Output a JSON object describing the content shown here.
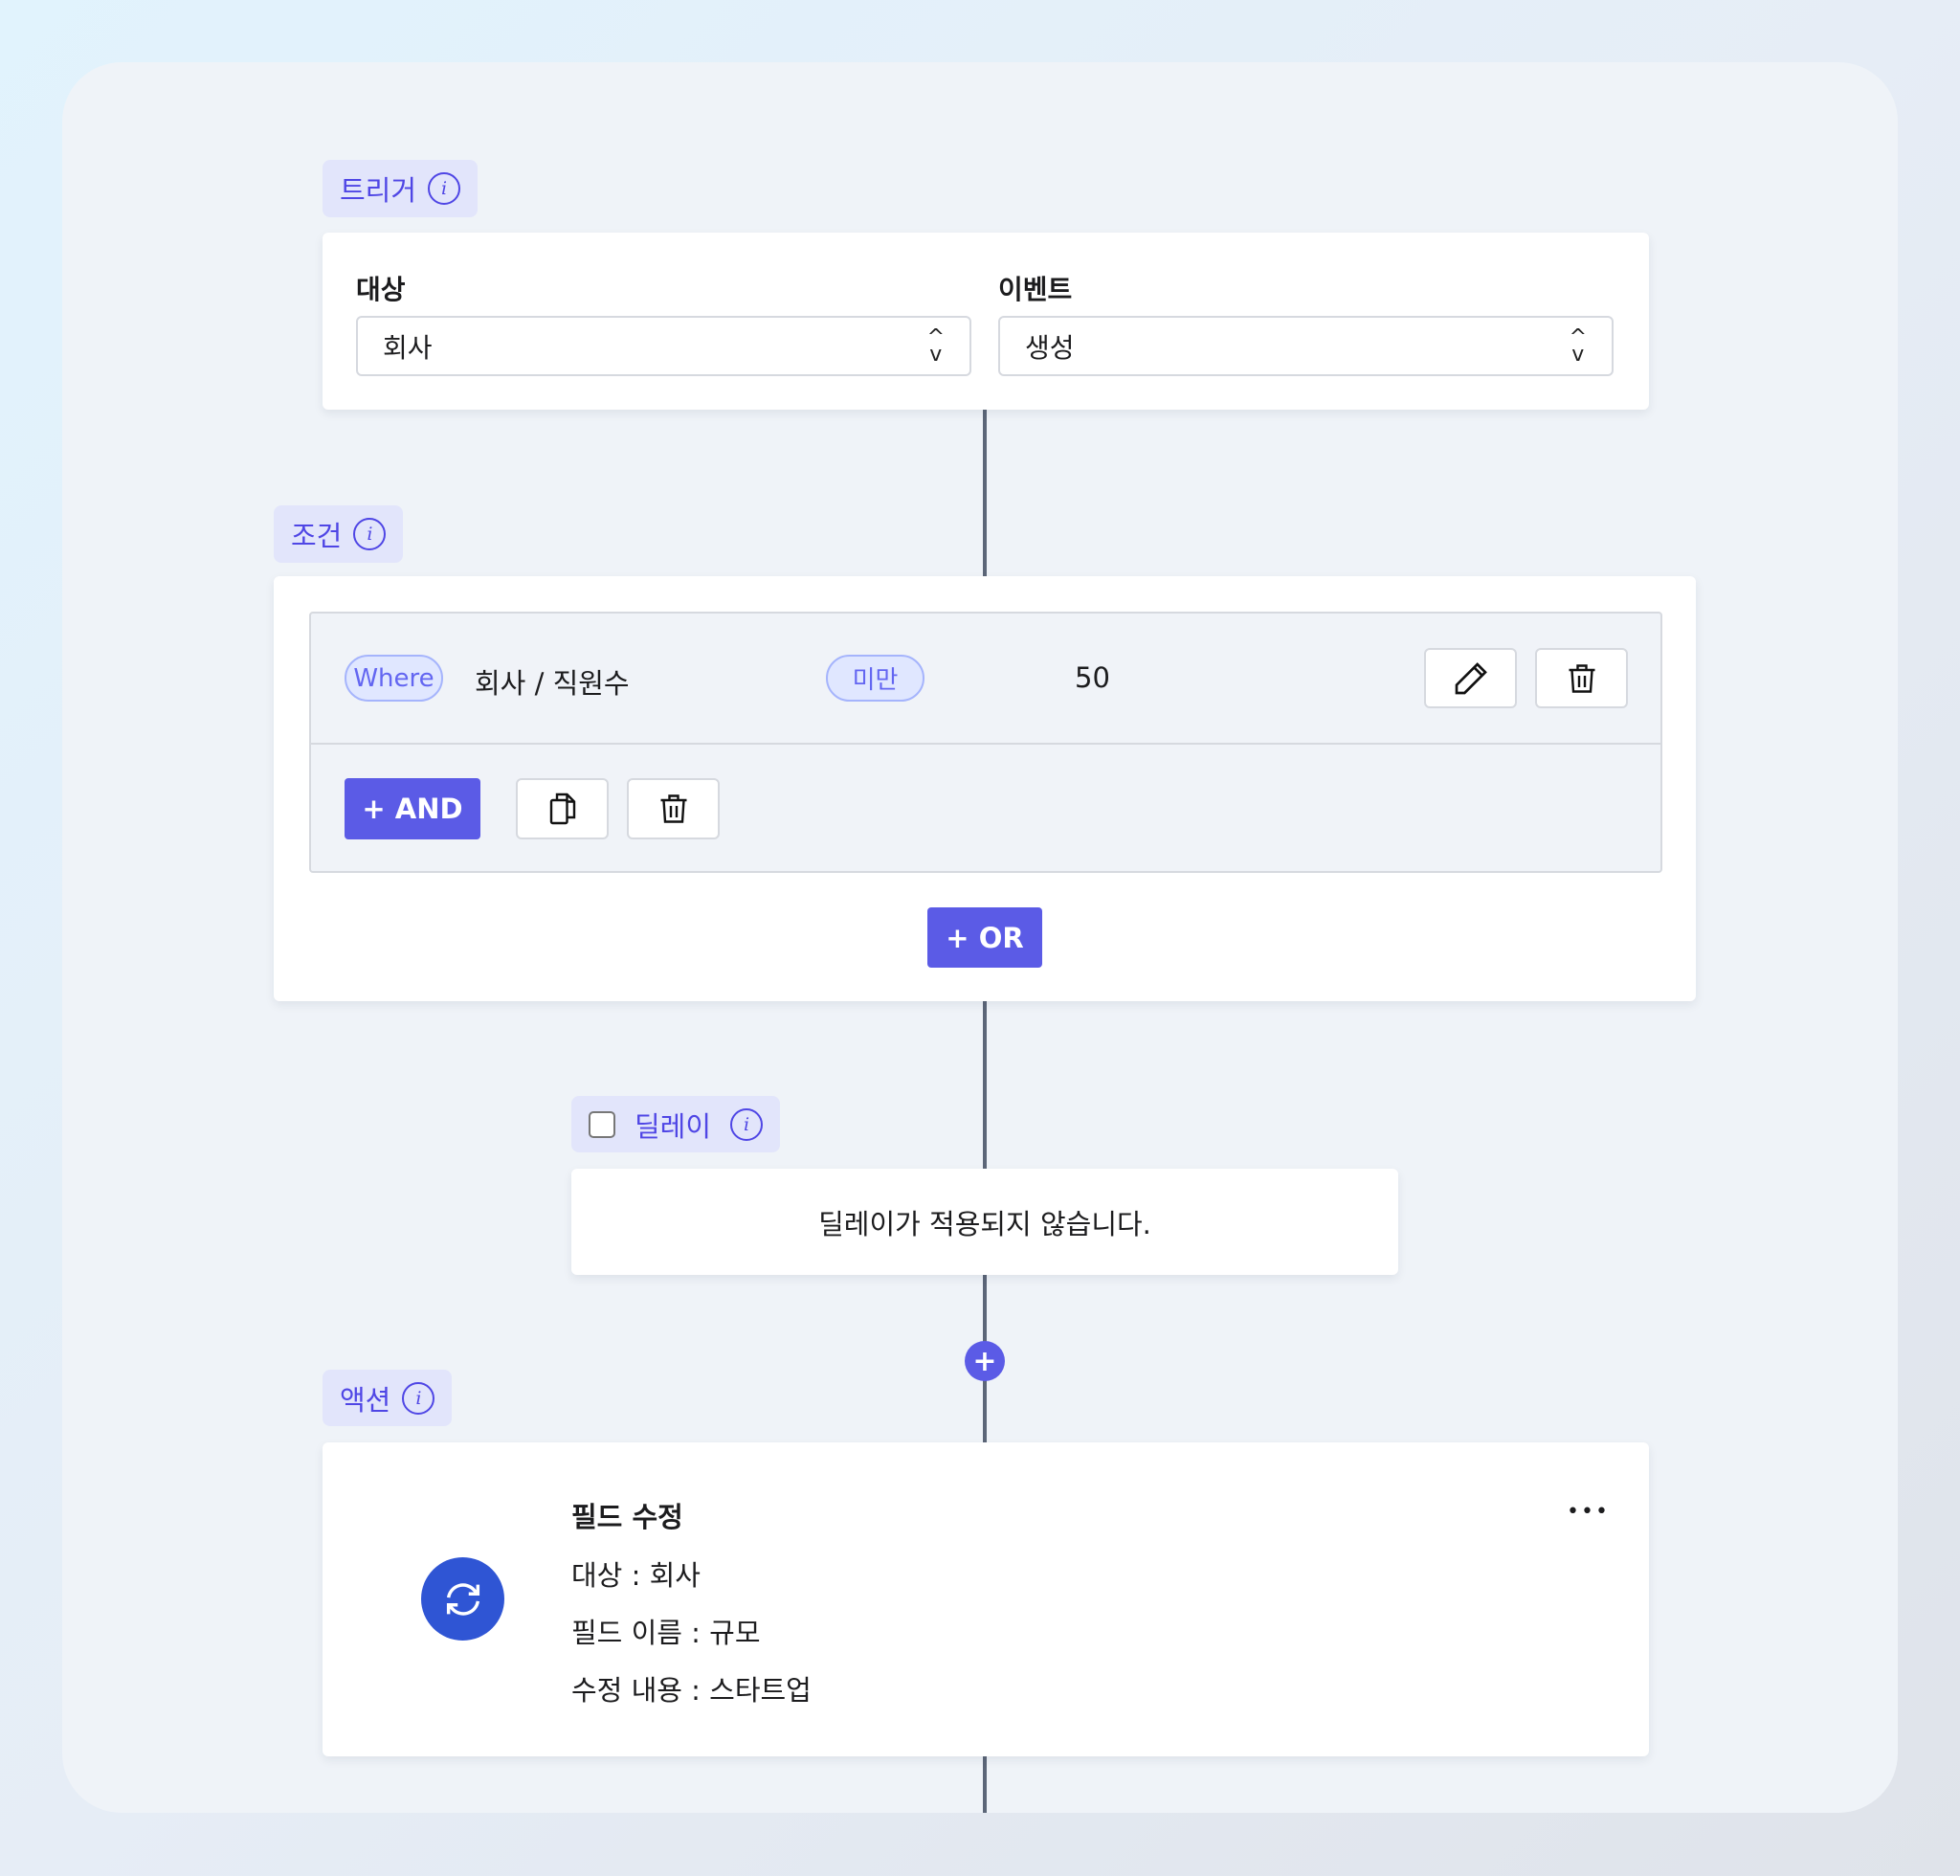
{
  "trigger": {
    "label": "트리거",
    "target_label": "대상",
    "target_value": "회사",
    "event_label": "이벤트",
    "event_value": "생성"
  },
  "condition": {
    "label": "조건",
    "where": "Where",
    "field": "회사 / 직원수",
    "operator": "미만",
    "value": "50",
    "and_label": "+ AND",
    "or_label": "+ OR"
  },
  "delay": {
    "label": "딜레이",
    "checked": false,
    "message": "딜레이가 적용되지 않습니다."
  },
  "action": {
    "label": "액션",
    "title": "필드 수정",
    "target": "대상 : 회사",
    "field_name": "필드 이름 : 규모",
    "content": "수정 내용 : 스타트업",
    "more": "•••",
    "icon": "refresh-icon"
  },
  "colors": {
    "accent": "#5b5be6",
    "action_icon": "#2f55d4",
    "tag_bg": "#e2e5fb"
  }
}
